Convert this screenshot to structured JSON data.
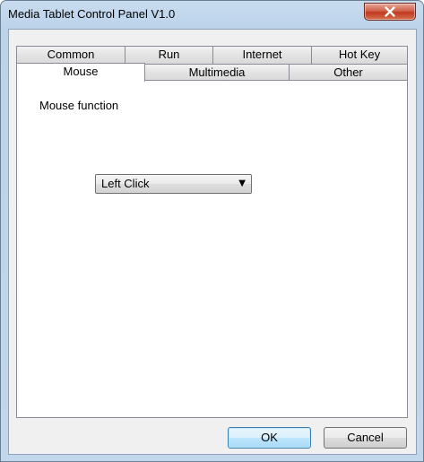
{
  "window": {
    "title": "Media Tablet Control Panel V1.0"
  },
  "tabs": {
    "row_back": [
      {
        "label": "Common"
      },
      {
        "label": "Run"
      },
      {
        "label": "Internet"
      },
      {
        "label": "Hot Key"
      }
    ],
    "row_front": [
      {
        "label": "Mouse",
        "selected": true
      },
      {
        "label": "Multimedia",
        "selected": false
      },
      {
        "label": "Other",
        "selected": false
      }
    ]
  },
  "mouse_panel": {
    "label": "Mouse function",
    "dropdown": {
      "selected": "Left Click",
      "arrow_icon": "triangle-down-icon"
    }
  },
  "buttons": {
    "ok": "OK",
    "cancel": "Cancel"
  },
  "colors": {
    "titlebar": "#c2d7ec",
    "close_button": "#c0391f",
    "dialog_face": "#f0f0f0",
    "default_button": "#bee6fd"
  }
}
